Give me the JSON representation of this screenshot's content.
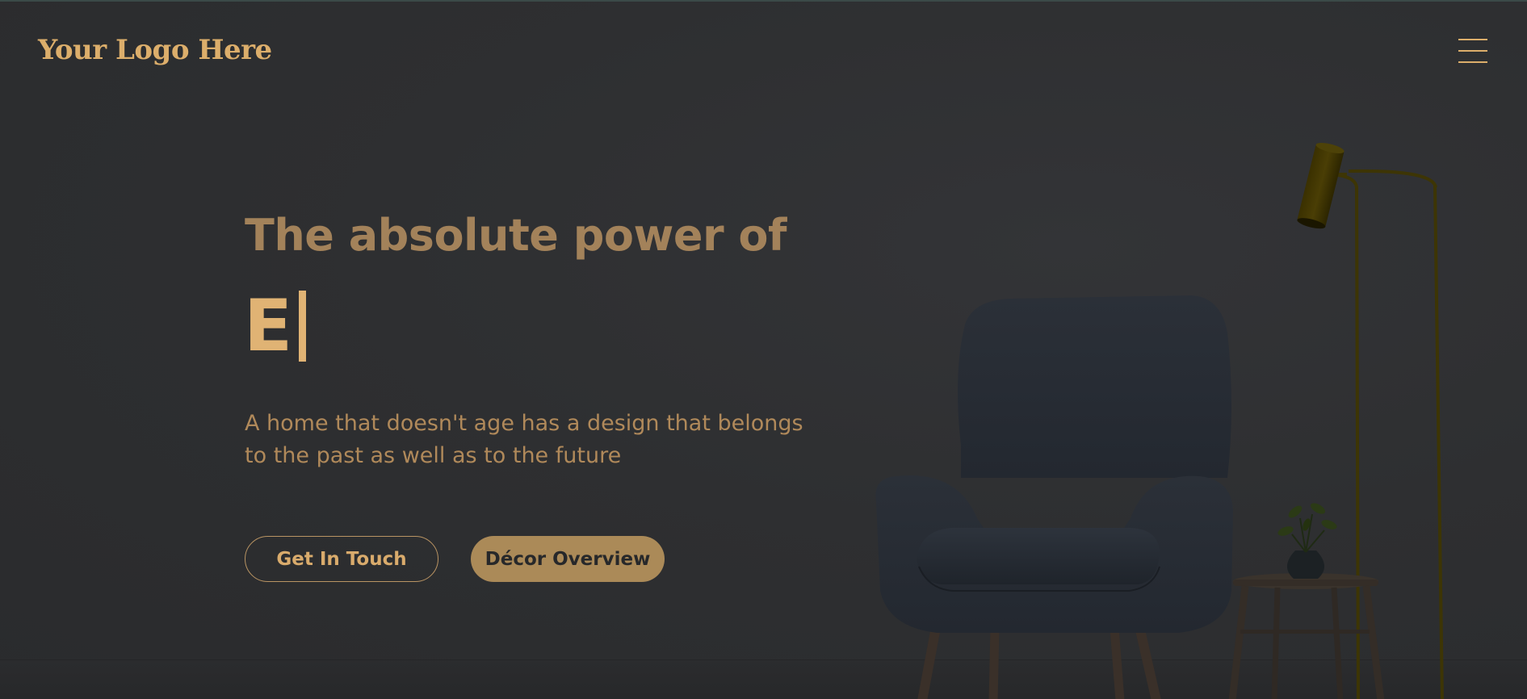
{
  "header": {
    "logo_text": "Your Logo Here",
    "menu_icon": "hamburger-menu-icon"
  },
  "hero": {
    "title": "The absolute power of",
    "typed_text": "E",
    "subtitle": "A home that doesn't age has a design that belongs to the past as well as to the future",
    "primary_button": "Get In Touch",
    "secondary_button": "Décor Overview"
  },
  "colors": {
    "background": "#2e2f31",
    "accent_gold": "#dcae6b",
    "title_gold": "#a3825a",
    "button_fill": "#ab8a58"
  }
}
